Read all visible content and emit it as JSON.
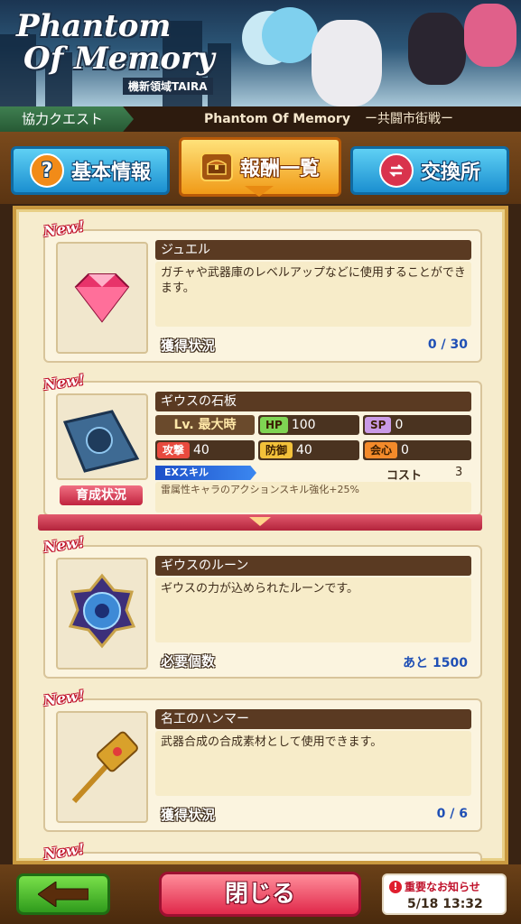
{
  "banner": {
    "logo_line1": "Phantom",
    "logo_line2": "Of Memory",
    "logo_subtitle": "機新領域TAIRA"
  },
  "quest_bar": {
    "tag": "協力クエスト",
    "title": "Phantom Of Memory",
    "subtitle": "ー共闘市街戦ー"
  },
  "tabs": [
    {
      "label": "基本情報",
      "icon": "question-icon",
      "active": false
    },
    {
      "label": "報酬一覧",
      "icon": "treasure-chest-icon",
      "active": true
    },
    {
      "label": "交換所",
      "icon": "exchange-icon",
      "active": false
    }
  ],
  "new_badge": "New!",
  "items": [
    {
      "name": "ジュエル",
      "description": "ガチャや武器庫のレベルアップなどに使用することができます。",
      "footer_label": "獲得状況",
      "footer_value": "0 / 30",
      "icon": "jewel-icon"
    },
    {
      "name": "ギウスの石板",
      "icon": "stone-tablet-icon",
      "level_label": "Lv. 最大時",
      "stats": {
        "hp_label": "HP",
        "hp": "100",
        "sp_label": "SP",
        "sp": "0",
        "atk_label": "攻撃",
        "atk": "40",
        "def_label": "防御",
        "def": "40",
        "crit_label": "会心",
        "crit": "0"
      },
      "skill_label": "EXスキル",
      "cost_label": "コスト",
      "cost": "3",
      "skill_desc": "雷属性キャラのアクションスキル強化+25%",
      "growth_button": "育成状況"
    },
    {
      "name": "ギウスのルーン",
      "description": "ギウスの力が込められたルーンです。",
      "footer_label": "必要個数",
      "footer_value": "あと 1500",
      "icon": "rune-icon"
    },
    {
      "name": "名工のハンマー",
      "description": "武器合成の合成素材として使用できます。",
      "footer_label": "獲得状況",
      "footer_value": "0 / 6",
      "icon": "hammer-icon"
    }
  ],
  "bottom": {
    "close_label": "閉じる",
    "notice_title": "重要なお知らせ",
    "notice_datetime": "5/18 13:32"
  },
  "colors": {
    "accent_gold": "#f09a17",
    "tab_blue": "#1b8fd0",
    "close_red": "#e0284a",
    "back_green": "#2f9b1c"
  }
}
